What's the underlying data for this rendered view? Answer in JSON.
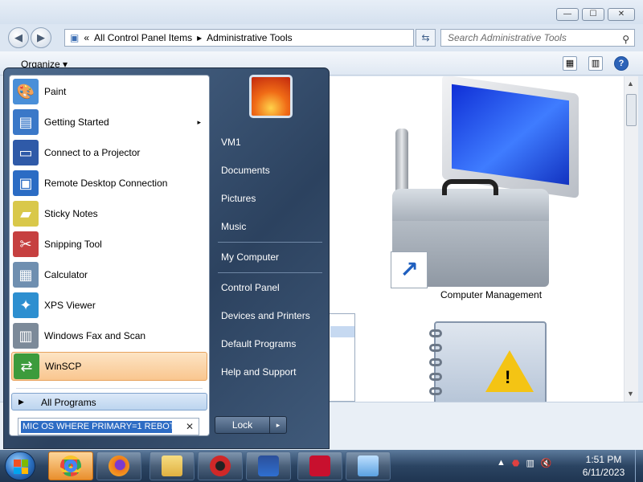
{
  "window": {
    "caption_buttons": {
      "minimize": "—",
      "maximize": "☐",
      "close": "✕"
    },
    "breadcrumb": [
      "All Control Panel Items",
      "Administrative Tools"
    ],
    "breadcrumb_sep": "▸",
    "breadcrumb_chevron": "«",
    "search_placeholder": "Search Administrative Tools",
    "organize_label": "Organize ▾",
    "content_items": [
      {
        "label": "Computer Management",
        "icon": "computer-management-icon"
      },
      {
        "label": "",
        "icon": "event-viewer-icon"
      }
    ]
  },
  "start_menu": {
    "programs": [
      {
        "label": "Paint",
        "icon": "paint-icon",
        "color": "#4a8fd8"
      },
      {
        "label": "Getting Started",
        "icon": "getting-started-icon",
        "color": "#3a78c8",
        "submenu": "▸"
      },
      {
        "label": "Connect to a Projector",
        "icon": "projector-icon",
        "color": "#2f5aa8"
      },
      {
        "label": "Remote Desktop Connection",
        "icon": "remote-desktop-icon",
        "color": "#2b6cc4"
      },
      {
        "label": "Sticky Notes",
        "icon": "sticky-notes-icon",
        "color": "#d9c84a"
      },
      {
        "label": "Snipping Tool",
        "icon": "scissors-icon",
        "color": "#c64040"
      },
      {
        "label": "Calculator",
        "icon": "calculator-icon",
        "color": "#6f8fb0"
      },
      {
        "label": "XPS Viewer",
        "icon": "xps-viewer-icon",
        "color": "#2d8fd0"
      },
      {
        "label": "Windows Fax and Scan",
        "icon": "fax-icon",
        "color": "#7c8a99"
      },
      {
        "label": "WinSCP",
        "icon": "winscp-icon",
        "color": "#3c9b3c",
        "highlighted": true
      }
    ],
    "all_programs": "All Programs",
    "search_value": "MIC OS WHERE PRIMARY=1 REBOT",
    "right_links": [
      "VM1",
      "Documents",
      "Pictures",
      "Music",
      "My Computer",
      "Control Panel",
      "Devices and Printers",
      "Default Programs",
      "Help and Support"
    ],
    "lock_label": "Lock",
    "lock_arrow": "▸"
  },
  "taskbar": {
    "apps": [
      {
        "name": "chrome",
        "color": "#e8453c",
        "active": true
      },
      {
        "name": "firefox",
        "color": "#f07a1a"
      },
      {
        "name": "file-explorer",
        "color": "#e8c24a"
      },
      {
        "name": "app-red-gear",
        "color": "#d02828"
      },
      {
        "name": "app-screen-capture",
        "color": "#2f6fd0"
      },
      {
        "name": "app-recorder",
        "color": "#c8102e"
      },
      {
        "name": "control-panel",
        "color": "#5aa0e0"
      }
    ],
    "tray": {
      "chevron": "▲",
      "time": "1:51 PM",
      "date": "6/11/2023"
    }
  }
}
